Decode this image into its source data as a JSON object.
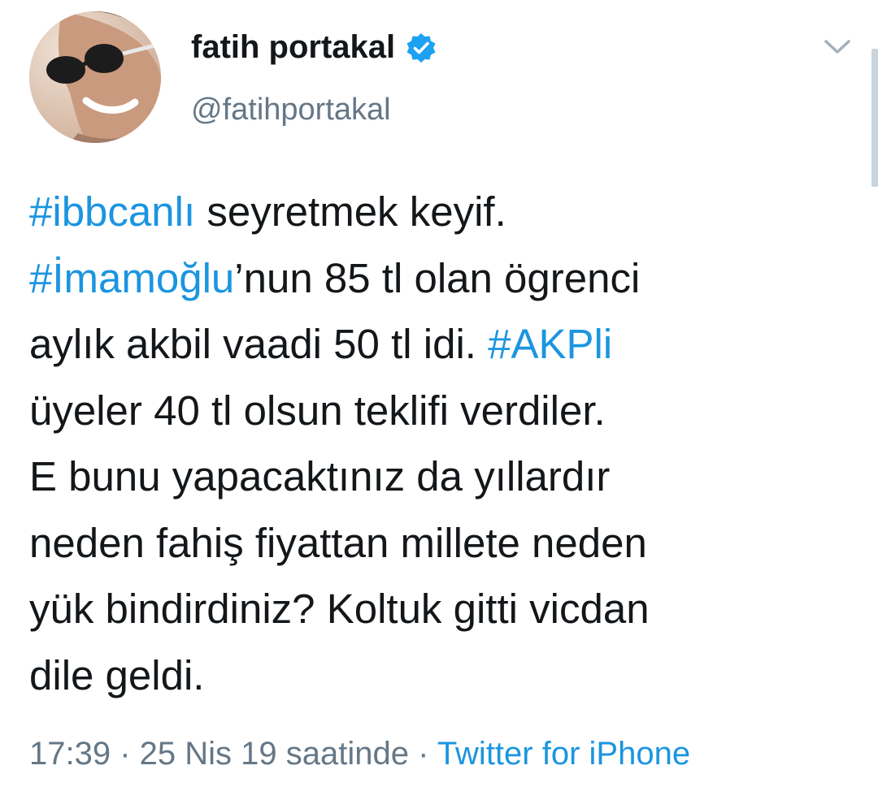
{
  "user": {
    "display_name": "fatih portakal",
    "handle": "@fatihportakal",
    "verified_icon": "verified-badge-icon",
    "avatar": "profile-photo"
  },
  "menu": {
    "icon": "chevron-down-icon"
  },
  "tweet": {
    "lines": [
      [
        {
          "t": "#ibbcanlı",
          "tag": true
        },
        {
          "t": " seyretmek keyif.",
          "tag": false
        }
      ],
      [
        {
          "t": "#İmamoğlu",
          "tag": true
        },
        {
          "t": "’nun 85 tl olan ögrenci",
          "tag": false
        }
      ],
      [
        {
          "t": "aylık akbil vaadi 50 tl idi. ",
          "tag": false
        },
        {
          "t": "#AKPli",
          "tag": true
        }
      ],
      [
        {
          "t": "üyeler 40 tl olsun teklifi verdiler.",
          "tag": false
        }
      ],
      [
        {
          "t": "E bunu yapacaktınız da yıllardır",
          "tag": false
        }
      ],
      [
        {
          "t": "neden fahiş fiyattan millete neden",
          "tag": false
        }
      ],
      [
        {
          "t": "yük bindirdiniz? Koltuk gitti vicdan",
          "tag": false
        }
      ],
      [
        {
          "t": "dile geldi.",
          "tag": false
        }
      ]
    ]
  },
  "meta": {
    "time": "17:39",
    "separator": " · ",
    "date": "25 Nis 19 saatinde",
    "source": "Twitter for iPhone"
  },
  "colors": {
    "link": "#1b95e0",
    "text": "#14171a",
    "muted": "#657786"
  }
}
